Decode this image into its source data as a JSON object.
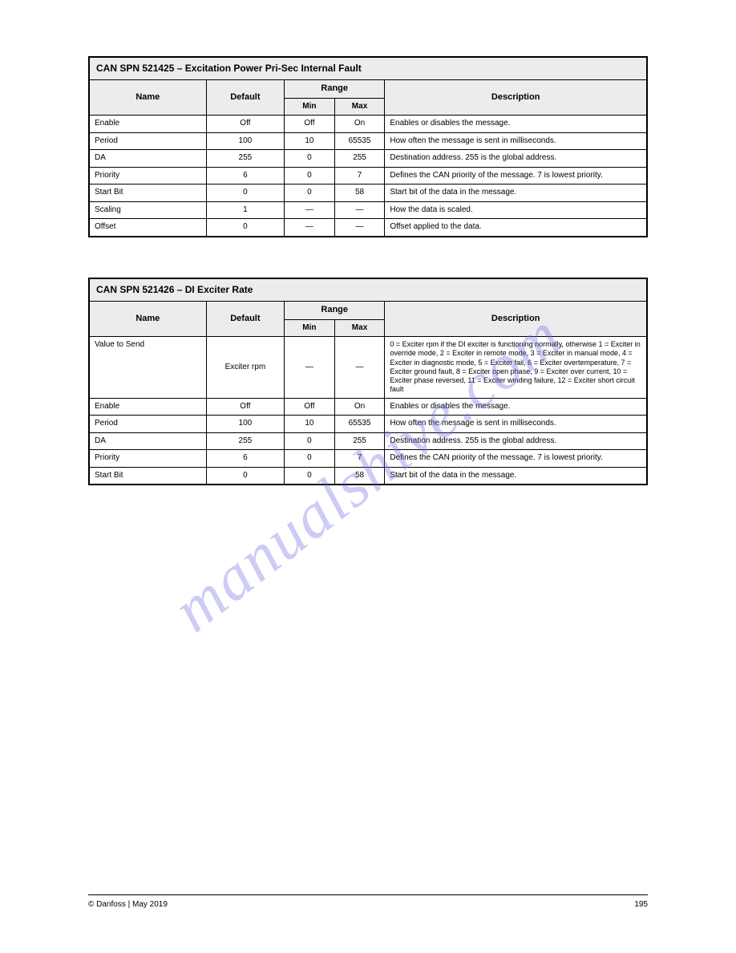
{
  "watermark": "manualshive.com",
  "table1": {
    "title": "CAN SPN 521425 – Excitation Power Pri-Sec Internal Fault",
    "headers": {
      "name": "Name",
      "default": "Default",
      "range": "Range",
      "min": "Min",
      "max": "Max",
      "description": "Description"
    },
    "rows": [
      {
        "name": "Enable",
        "default": "Off",
        "min": "Off",
        "max": "On",
        "description": "Enables or disables the message."
      },
      {
        "name": "Period",
        "default": "100",
        "min": "10",
        "max": "65535",
        "description": "How often the message is sent in milliseconds."
      },
      {
        "name": "DA",
        "default": "255",
        "min": "0",
        "max": "255",
        "description": "Destination address. 255 is the global address."
      },
      {
        "name": "Priority",
        "default": "6",
        "min": "0",
        "max": "7",
        "description": "Defines the CAN priority of the message. 7 is lowest priority."
      },
      {
        "name": "Start Bit",
        "default": "0",
        "min": "0",
        "max": "58",
        "description": "Start bit of the data in the message."
      },
      {
        "name": "Scaling",
        "default": "1",
        "min": "—",
        "max": "—",
        "description": "How the data is scaled."
      },
      {
        "name": "Offset",
        "default": "0",
        "min": "—",
        "max": "—",
        "description": "Offset applied to the data."
      }
    ]
  },
  "table2": {
    "title": "CAN SPN 521426 – DI Exciter Rate",
    "headers": {
      "name": "Name",
      "default": "Default",
      "range": "Range",
      "min": "Min",
      "max": "Max",
      "description": "Description"
    },
    "rows": [
      {
        "name": "Value to Send",
        "default": "Exciter rpm",
        "min": "—",
        "max": "—",
        "description": "0 = Exciter rpm if the DI exciter is functioning normally, otherwise 1 = Exciter in override mode, 2 = Exciter in remote mode, 3 = Exciter in manual mode, 4 = Exciter in diagnostic mode, 5 = Exciter fail, 6 = Exciter overtemperature, 7 = Exciter ground fault, 8 = Exciter open phase, 9 = Exciter over current, 10 = Exciter phase reversed, 11 = Exciter winding failure, 12 = Exciter short circuit fault"
      },
      {
        "name": "Enable",
        "default": "Off",
        "min": "Off",
        "max": "On",
        "description": "Enables or disables the message."
      },
      {
        "name": "Period",
        "default": "100",
        "min": "10",
        "max": "65535",
        "description": "How often the message is sent in milliseconds."
      },
      {
        "name": "DA",
        "default": "255",
        "min": "0",
        "max": "255",
        "description": "Destination address. 255 is the global address."
      },
      {
        "name": "Priority",
        "default": "6",
        "min": "0",
        "max": "7",
        "description": "Defines the CAN priority of the message. 7 is lowest priority."
      },
      {
        "name": "Start Bit",
        "default": "0",
        "min": "0",
        "max": "58",
        "description": "Start bit of the data in the message."
      }
    ]
  },
  "footer": {
    "left": "© Danfoss | May 2019",
    "right": "195"
  }
}
